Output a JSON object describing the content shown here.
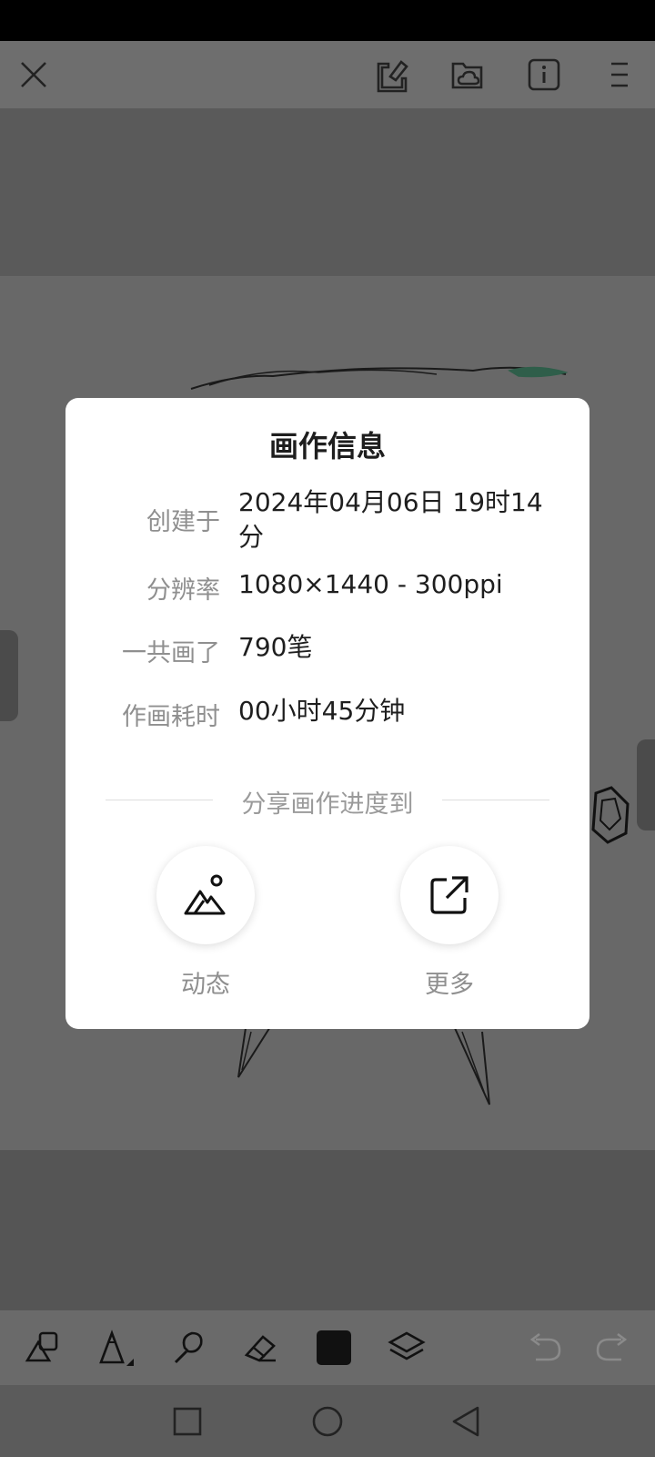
{
  "topbar": {
    "icons": [
      "close-icon",
      "export-icon",
      "folder-cloud-icon",
      "info-icon",
      "menu-icon"
    ]
  },
  "dialog": {
    "title": "画作信息",
    "rows": [
      {
        "label": "创建于",
        "value": "2024年04月06日 19时14分"
      },
      {
        "label": "分辨率",
        "value": "1080×1440 - 300ppi"
      },
      {
        "label": "一共画了",
        "value": "790笔"
      },
      {
        "label": "作画耗时",
        "value": "00小时45分钟"
      }
    ],
    "share_title": "分享画作进度到",
    "share_options": [
      {
        "label": "动态",
        "icon": "mountain-sun-icon"
      },
      {
        "label": "更多",
        "icon": "share-external-icon"
      }
    ]
  },
  "toolbar": {
    "tools": [
      "shapes-icon",
      "pencil-icon",
      "brush-icon",
      "eraser-icon",
      "color-swatch",
      "layers-icon",
      "undo-icon",
      "redo-icon"
    ],
    "current_color": "#111111"
  },
  "navbar": {
    "buttons": [
      "recents-square-icon",
      "home-circle-icon",
      "back-triangle-icon"
    ]
  }
}
